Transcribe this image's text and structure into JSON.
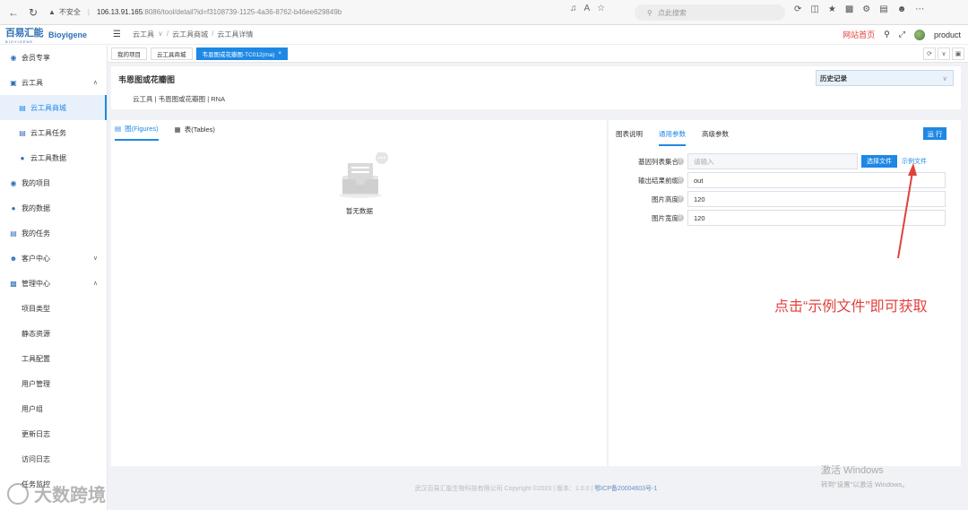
{
  "browser": {
    "insecure_label": "不安全",
    "url_host": "106.13.91.165",
    "url_path": ":8086/tool/detail?id=f3108739-1125-4a36-8762-b46ee629849b",
    "search_placeholder": "点此搜索"
  },
  "header": {
    "logo_cn": "百易汇能",
    "logo_sub": "BIOYIGENE",
    "logo_en": "Bioyigene",
    "breadcrumb": [
      "云工具",
      "云工具商城",
      "云工具详情"
    ],
    "site_home": "网站首页",
    "user": "product"
  },
  "tabs": [
    {
      "label": "我的项目",
      "active": false
    },
    {
      "label": "云工具商城",
      "active": false
    },
    {
      "label": "韦恩图或花瓣图-TC012(rna)",
      "active": true
    }
  ],
  "sidebar": {
    "items": [
      {
        "label": "会员专享"
      },
      {
        "label": "云工具"
      },
      {
        "label": "云工具商城"
      },
      {
        "label": "云工具任务"
      },
      {
        "label": "云工具数据"
      },
      {
        "label": "我的项目"
      },
      {
        "label": "我的数据"
      },
      {
        "label": "我的任务"
      },
      {
        "label": "客户中心"
      },
      {
        "label": "管理中心"
      },
      {
        "label": "项目类型"
      },
      {
        "label": "静态资源"
      },
      {
        "label": "工具配置"
      },
      {
        "label": "用户管理"
      },
      {
        "label": "用户组"
      },
      {
        "label": "更新日志"
      },
      {
        "label": "访问日志"
      },
      {
        "label": "任务监控"
      }
    ]
  },
  "tool": {
    "title": "韦恩图或花瓣图",
    "meta": "云工具 | 韦恩图或花瓣图 | RNA",
    "history_label": "历史记录"
  },
  "left_panel": {
    "tab_figures": "图(Figures)",
    "tab_tables": "表(Tables)",
    "empty_text": "暂无数据"
  },
  "right_panel": {
    "tabs": [
      "图表说明",
      "通用参数",
      "高级参数"
    ],
    "run_label": "运 行",
    "fields": [
      {
        "label": "基因列表集合",
        "value": "",
        "placeholder": "请输入"
      },
      {
        "label": "输出结果前缀",
        "value": "out",
        "placeholder": ""
      },
      {
        "label": "图片高度",
        "value": "120",
        "placeholder": ""
      },
      {
        "label": "图片宽度",
        "value": "120",
        "placeholder": ""
      }
    ],
    "choose_file": "选择文件",
    "sample_file": "示例文件"
  },
  "annotation": "点击“示例文件”即可获取",
  "footer": {
    "copyright": "武汉百易汇能生物科技有限公司 Copyright ©2023 | 版本：1.0.0 |",
    "icp": "鄂ICP备20004603号-1"
  },
  "windows_watermark": {
    "line1": "激活 Windows",
    "line2": "转到\"设置\"以激活 Windows。"
  },
  "brand_watermark": "大数跨境",
  "colors": {
    "accent": "#1e88e5",
    "annotation_red": "#e0413c"
  }
}
